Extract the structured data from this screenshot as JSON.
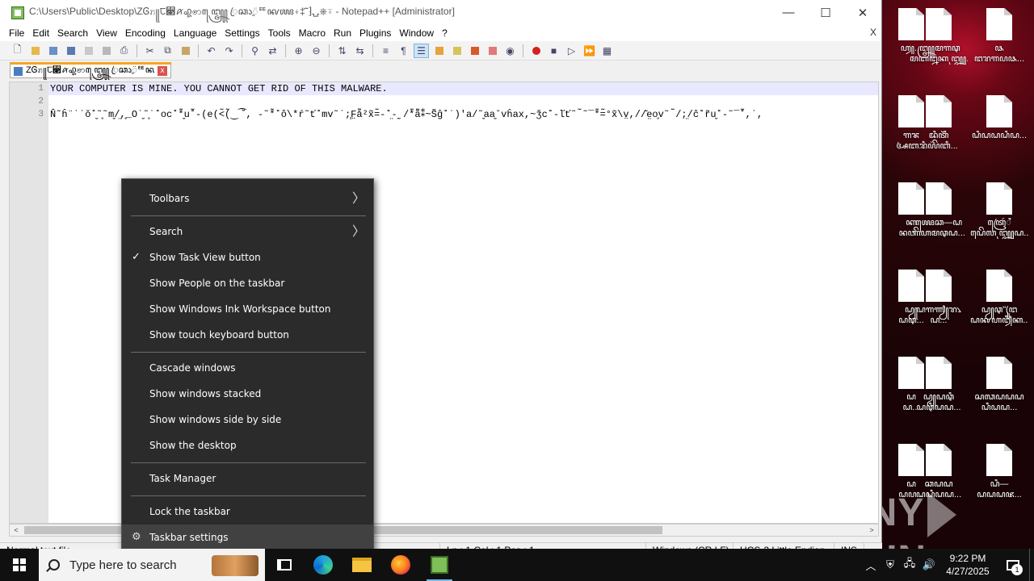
{
  "window": {
    "title": "C:\\Users\\Public\\Desktop\\ZᎶꤊ꧋ꫡ꫃ꪁ꩗ꩦ꧃ꦺꦿꦕꦵꥍ̈ꥹꦑꦖ⍖‡̈˜⁆⍽⎈⍤ - Notepad++ [Administrator]",
    "minimize": "—",
    "maximize": "☐",
    "close": "✕"
  },
  "menu": {
    "items": [
      "File",
      "Edit",
      "Search",
      "View",
      "Encoding",
      "Language",
      "Settings",
      "Tools",
      "Macro",
      "Run",
      "Plugins",
      "Window",
      "?"
    ],
    "close": "X"
  },
  "tab": {
    "title": "ZᎶꤊ꧋ꫡ꫃ꪁ꩗ꩦ꧃ꦺꦿꦕꦵꥍ̈ꥹꦑꦖ⍖‡̈˜⁆⍽⎈⍤",
    "close": "x"
  },
  "editor": {
    "line_numbers": [
      "1",
      "2",
      "3"
    ],
    "lines": [
      "YOUR COMPUTER IS MINE. YOU CANNOT GET RID OF THIS MALWARE.",
      "",
      "N̂˜ĥ¨˙˙ŏ˚̬˜̥˜m̬/̤,̥_O˙̬˜̥˙˚oc˚*̬̃u˚̃-(e(<̃(̃‿⁀̆, -˜*̃˚ô\\*ŕ˜ť˚mv˜˙;̧F̤ā̃̃²x̃=̃-˚̤-˷/*̃ã̃⁑~S̃ĝ˚˙)'a/˜̬aa̬ˇvĥax,~ǯc˚-ľť˜ ̃˜‾*̃=̃°x̃\\v̤,//̆e̤o̥v˜ ̃/;̤/ĉ˚r̃u̬˚-˜‾˚̃,˙,"
    ]
  },
  "scrollbar": {
    "left_arrow": "<",
    "right_arrow": ">"
  },
  "status": {
    "cells": [
      "Normal text file",
      "Ln : 1    Col : 1    Pos : 1",
      "Windows (CR LF)",
      "UCS-2 Little Endian",
      "INS"
    ]
  },
  "context_menu": {
    "items": [
      {
        "label": "Toolbars",
        "submenu": true
      },
      {
        "label": "Search",
        "submenu": true
      },
      {
        "label": "Show Task View button",
        "checked": true
      },
      {
        "label": "Show People on the taskbar"
      },
      {
        "label": "Show Windows Ink Workspace button"
      },
      {
        "label": "Show touch keyboard button"
      },
      {
        "label": "Cascade windows"
      },
      {
        "label": "Show windows stacked"
      },
      {
        "label": "Show windows side by side"
      },
      {
        "label": "Show the desktop"
      },
      {
        "label": "Task Manager"
      },
      {
        "label": "Lock the taskbar"
      },
      {
        "label": "Taskbar settings",
        "icon": "gear-icon",
        "hover": true
      }
    ],
    "submenu_arrow": "〉",
    "check_mark": "✓",
    "gear_glyph": "⚙"
  },
  "taskbar": {
    "search_placeholder": "Type here to search",
    "time": "9:22 PM",
    "date": "4/27/2025",
    "notification_count": "1",
    "tray_chevron": "︿"
  },
  "desktop": {
    "icons": [
      {
        "label": "ꦲꦾ..."
      },
      {
        "label": "꧄ꦩ꧑ꦡ\nꦩꦧꦊꦏ꧃..."
      },
      {
        "label": "ꦦ\nꦔꦫꦒꦥꦦ..."
      },
      {
        "label": "ꦒꦨ\nꦄꦧ..."
      },
      {
        "label": "ꦢꦶꦠꦼꦶ\nꦫꦶꦪ꦳ꦼꦧꦶ..."
      },
      {
        "label": "ꦝꦶꦝꦝꦝꦶꦝ..."
      },
      {
        "label": "ꦏ\nꦤꦮ..."
      },
      {
        "label": "ꦖꦺꦕ—ꦝ\nꦒꦼꦲꦩꦡꦝ..."
      },
      {
        "label": "ꦠꦿꦺꦂꦶ\nꦝꦺꦼꦭ꧃ꦝ..."
      },
      {
        "label": "ꦝꦾ\nꦝꦡ..."
      },
      {
        "label": "ꦝ꧑ꦬꦾꦫ꧈\nꦝ..."
      },
      {
        "label": "ꦝꦾꦡ\"(ꦸꦔ\nꦝꦑꦲꦙꦶꦏ..."
      },
      {
        "label": "ꦝ\nꦝ..."
      },
      {
        "label": "ꦝꦾꦝꦡꦶ\nꦝꦡꦶꦝꦝ..."
      },
      {
        "label": "ꦱꦓꦝꦝꦝ\nꦝꦶꦝꦝ..."
      },
      {
        "label": "ꦝ\nꦝꦥ..."
      },
      {
        "label": "ꦕꦝꦝ\nꦝꦝꦶꦝꦝ..."
      },
      {
        "label": "ꦝꦶ—\nꦝꦝꦝꦗ..."
      }
    ],
    "watermark": "ANY RUN"
  }
}
